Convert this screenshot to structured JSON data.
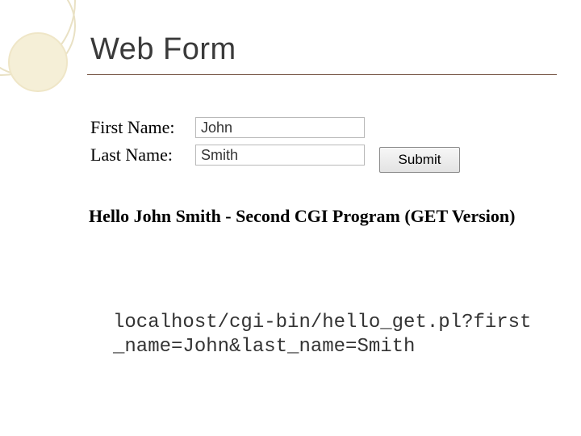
{
  "title": "Web Form",
  "form": {
    "first_name_label": "First Name:",
    "last_name_label": "Last Name:",
    "first_name_value": "John",
    "last_name_value": "Smith",
    "submit_label": "Submit"
  },
  "result_heading": "Hello John Smith - Second CGI Program (GET Version)",
  "url": "localhost/cgi-bin/hello_get.pl?first_name=John&last_name=Smith"
}
